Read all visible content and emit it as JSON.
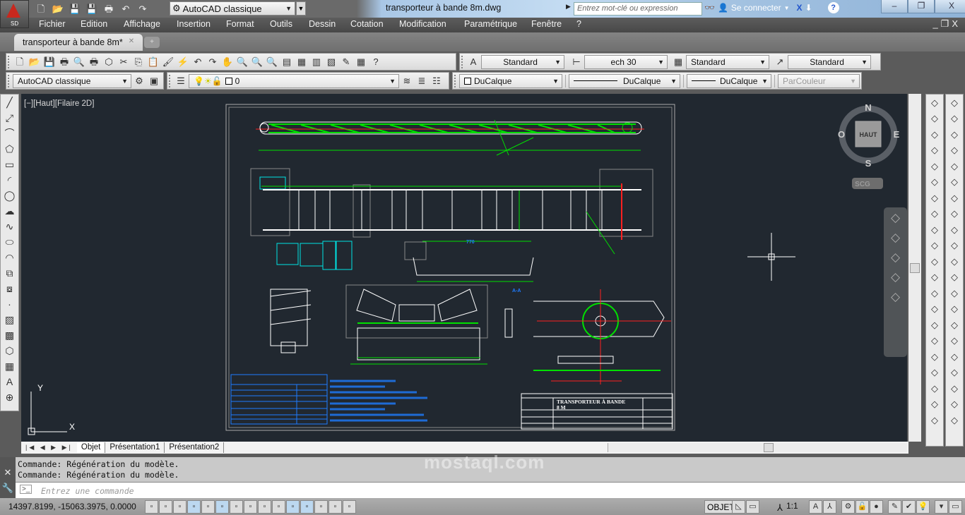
{
  "app": {
    "logo_text": "SD",
    "document_title": "transporteur à bande 8m.dwg"
  },
  "quick_access": {
    "icons": [
      "new-icon",
      "open-icon",
      "save-icon",
      "save-as-icon",
      "print-icon",
      "undo-icon",
      "redo-icon"
    ],
    "workspace": "AutoCAD classique"
  },
  "search": {
    "placeholder": "Entrez mot-clé ou expression"
  },
  "account": {
    "login_label": "Se connecter"
  },
  "menu": [
    "Fichier",
    "Edition",
    "Affichage",
    "Insertion",
    "Format",
    "Outils",
    "Dessin",
    "Cotation",
    "Modification",
    "Paramétrique",
    "Fenêtre",
    "?"
  ],
  "tabs": {
    "document_tab": "transporteur à bande 8m*"
  },
  "toolbar_standard": {
    "icons": [
      "new-icon",
      "open-icon",
      "save-icon",
      "print-icon",
      "preview-icon",
      "plot-icon",
      "publish-icon",
      "cut-icon",
      "copy-icon",
      "paste-icon",
      "match-properties-icon",
      "block-editor-icon",
      "undo-icon",
      "redo-icon",
      "pan-icon",
      "zoom-realtime-icon",
      "zoom-window-icon",
      "zoom-previous-icon",
      "properties-icon",
      "design-center-icon",
      "tool-palettes-icon",
      "sheet-set-icon",
      "markup-icon",
      "calculator-icon",
      "help-icon"
    ],
    "text_style": "Standard",
    "dim_style": "ech 30",
    "table_style": "Standard",
    "mleader_style": "Standard"
  },
  "toolbar_layers": {
    "workspace": "AutoCAD classique",
    "layer": "0",
    "color": "DuCalque",
    "linetype": "DuCalque",
    "lineweight": "DuCalque",
    "plot_style": "ParCouleur"
  },
  "viewport": {
    "label": "[−][Haut][Filaire 2D]"
  },
  "viewcube": {
    "north": "N",
    "south": "S",
    "east": "E",
    "west": "O",
    "face": "HAUT",
    "ucs": "SCG"
  },
  "drawing": {
    "title_block": [
      "TRANSPORTEUR À BANDE",
      "8 M"
    ],
    "section_label": "A-A",
    "dimension_770": "770"
  },
  "draw_tools": [
    "line-icon",
    "construction-line-icon",
    "polyline-icon",
    "polygon-icon",
    "rectangle-icon",
    "arc-icon",
    "circle-icon",
    "revision-cloud-icon",
    "spline-icon",
    "ellipse-icon",
    "ellipse-arc-icon",
    "insert-block-icon",
    "make-block-icon",
    "point-icon",
    "hatch-icon",
    "gradient-icon",
    "region-icon",
    "table-icon",
    "multiline-text-icon",
    "add-selected-icon"
  ],
  "modify_tools": [
    "erase-icon",
    "copy-object-icon",
    "mirror-icon",
    "offset-icon",
    "array-icon",
    "move-icon",
    "rotate-icon",
    "scale-icon",
    "stretch-icon",
    "trim-icon",
    "extend-icon",
    "break-at-point-icon",
    "break-icon",
    "join-icon",
    "chamfer-icon",
    "fillet-icon",
    "blend-icon",
    "explode-icon",
    "draw-order-icon",
    "draw-order-front-icon",
    "text-edit-icon"
  ],
  "dim_tools": [
    "linear-dim-icon",
    "aligned-dim-icon",
    "arc-length-icon",
    "ordinate-icon",
    "radius-icon",
    "jogged-icon",
    "diameter-icon",
    "angular-icon",
    "quick-dim-icon",
    "baseline-icon",
    "continue-icon",
    "space-icon",
    "break-dim-icon",
    "tolerance-icon",
    "center-mark-icon",
    "inspection-icon",
    "jogged-linear-icon",
    "dim-edit-icon",
    "dim-text-edit-icon",
    "dim-update-icon",
    "dim-style-icon"
  ],
  "nav_tools": [
    "steering-wheel-icon",
    "pan-hand-icon",
    "zoom-extents-icon",
    "orbit-icon",
    "showmotion-icon"
  ],
  "layout_tabs": [
    "Objet",
    "Présentation1",
    "Présentation2"
  ],
  "command": {
    "history": [
      "Commande:  Régénération du modèle.",
      "Commande:  Régénération du modèle."
    ],
    "placeholder": "Entrez une commande"
  },
  "status": {
    "coordinates": "14397.8199, -15063.3975, 0.0000",
    "toggles": [
      "infer-constraints-icon",
      "snap-icon",
      "grid-icon",
      "ortho-icon",
      "polar-icon",
      "osnap-icon",
      "3d-osnap-icon",
      "otrack-icon",
      "ducs-icon",
      "dynamic-input-icon",
      "lineweight-icon",
      "transparency-icon",
      "quick-properties-icon",
      "selection-cycling-icon",
      "annotation-monitor-icon"
    ],
    "toggles_on": [
      "ortho-icon",
      "osnap-icon",
      "lineweight-icon",
      "transparency-icon"
    ],
    "space": "OBJET",
    "annotation_scale": "1:1"
  },
  "watermark": "mostaql.com",
  "colors": {
    "canvas": "#212830",
    "green": "#00e000",
    "blue_text": "#1e7cff",
    "cyan": "#00e5e5",
    "red": "#ff2020"
  }
}
